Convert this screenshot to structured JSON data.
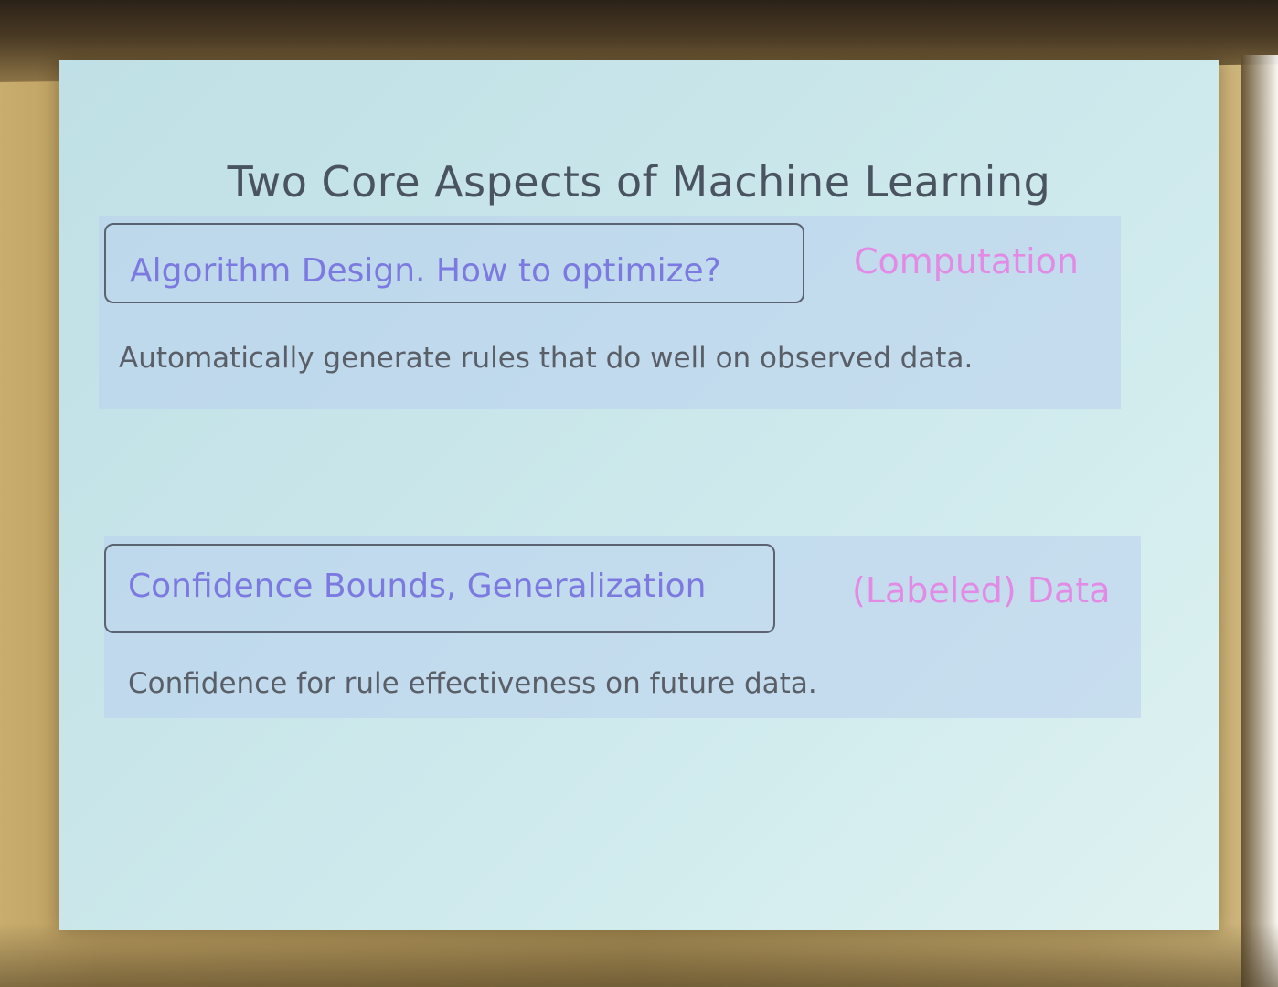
{
  "slide": {
    "title": "Two Core Aspects of Machine Learning",
    "aspects": [
      {
        "heading": "Algorithm Design. How to optimize?",
        "tag": "Computation",
        "description": "Automatically generate rules that do well on observed data."
      },
      {
        "heading": "Confidence Bounds, Generalization",
        "tag": "(Labeled) Data",
        "description": "Confidence for rule effectiveness on future data."
      }
    ]
  },
  "colors": {
    "heading_text": "#7c7ae0",
    "tag_text": "#e28be4",
    "title_text": "#4a5360",
    "body_text": "#5a5e66",
    "screen_bg": "#c9e6ea",
    "wall": "#b99c5f"
  }
}
